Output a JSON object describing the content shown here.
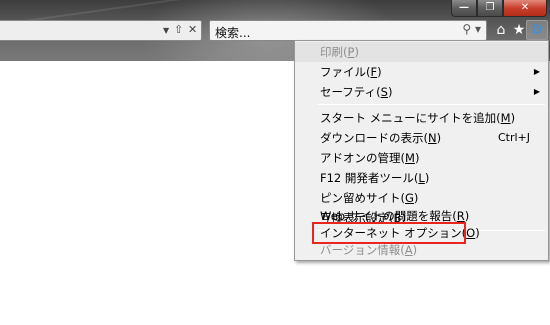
{
  "toolbar": {
    "search_placeholder": "検索...",
    "icons": [
      "dropdown-arrow-icon",
      "favorites-icon",
      "close-icon",
      "search-icon",
      "home-icon",
      "star-icon",
      "gear-icon"
    ]
  },
  "menu": {
    "items": [
      {
        "label": "印刷",
        "key": "P",
        "disabled": true
      },
      {
        "label": "ファイル",
        "key": "F",
        "submenu": true
      },
      {
        "label": "セーフティ",
        "key": "S",
        "submenu": true
      },
      {
        "label": "スタート メニューにサイトを追加",
        "key": "M"
      },
      {
        "label": "ダウンロードの表示",
        "key": "N",
        "shortcut": "Ctrl+J"
      },
      {
        "label": "アドオンの管理",
        "key": "M"
      },
      {
        "label": "F12 開発者ツール",
        "key": "L"
      },
      {
        "label": "ピン留めサイト",
        "key": "G"
      },
      {
        "label": "互換表示設定",
        "key": "B"
      },
      {
        "label": "Web サイトの問題を報告",
        "key": "R"
      },
      {
        "label": "インターネット オプション",
        "key": "O",
        "highlighted": true
      },
      {
        "label": "バージョン情報",
        "key": "A",
        "disabled": true
      }
    ]
  },
  "colors": {
    "highlight_border": "#e8261e",
    "close_button": "#c8402c"
  }
}
